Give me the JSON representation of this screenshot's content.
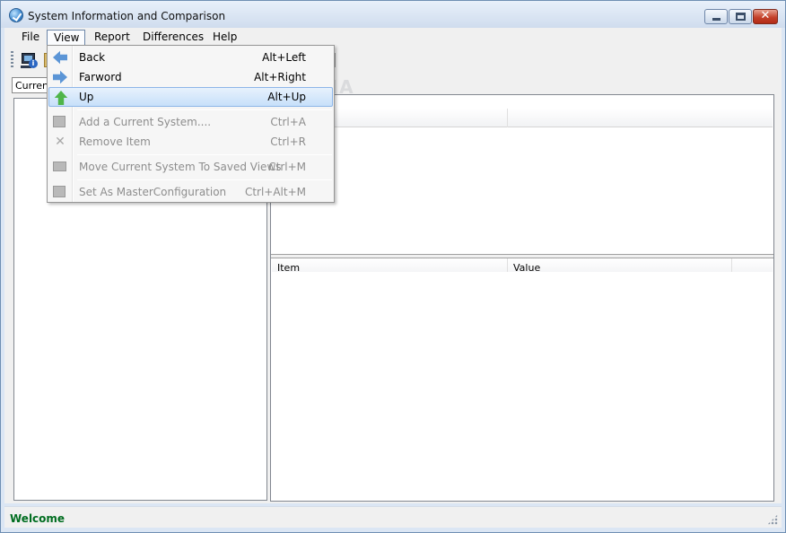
{
  "window": {
    "title": "System Information and Comparison"
  },
  "menubar": {
    "items": [
      {
        "label": "File"
      },
      {
        "label": "View"
      },
      {
        "label": "Report"
      },
      {
        "label": "Differences"
      },
      {
        "label": "Help"
      }
    ],
    "active_menu": "View"
  },
  "tabs": {
    "current_label": "Current"
  },
  "view_menu": {
    "items": [
      {
        "label": "Back",
        "shortcut": "Alt+Left",
        "icon": "back-arrow-icon",
        "enabled": true
      },
      {
        "label": "Farword",
        "shortcut": "Alt+Right",
        "icon": "forward-arrow-icon",
        "enabled": true
      },
      {
        "label": "Up",
        "shortcut": "Alt+Up",
        "icon": "up-arrow-icon",
        "enabled": true,
        "highlighted": true
      },
      {
        "label": "Add a Current System....",
        "shortcut": "Ctrl+A",
        "icon": "add-system-icon",
        "enabled": false
      },
      {
        "label": "Remove Item",
        "shortcut": "Ctrl+R",
        "icon": "remove-x-icon",
        "enabled": false
      },
      {
        "label": "Move  Current System To Saved Views",
        "shortcut": "Ctrl+M",
        "icon": "move-system-icon",
        "enabled": false
      },
      {
        "label": "Set As MasterConfiguration",
        "shortcut": "Ctrl+Alt+M",
        "icon": "master-config-icon",
        "enabled": false
      }
    ]
  },
  "details_list": {
    "columns": [
      {
        "label": "Item"
      },
      {
        "label": "Value"
      }
    ]
  },
  "statusbar": {
    "text": "Welcome"
  },
  "watermark": "SOFTPEDIA",
  "colors": {
    "status_text": "#006d20",
    "menu_highlight": "#c7e0fa",
    "close_button": "#c4412b"
  }
}
